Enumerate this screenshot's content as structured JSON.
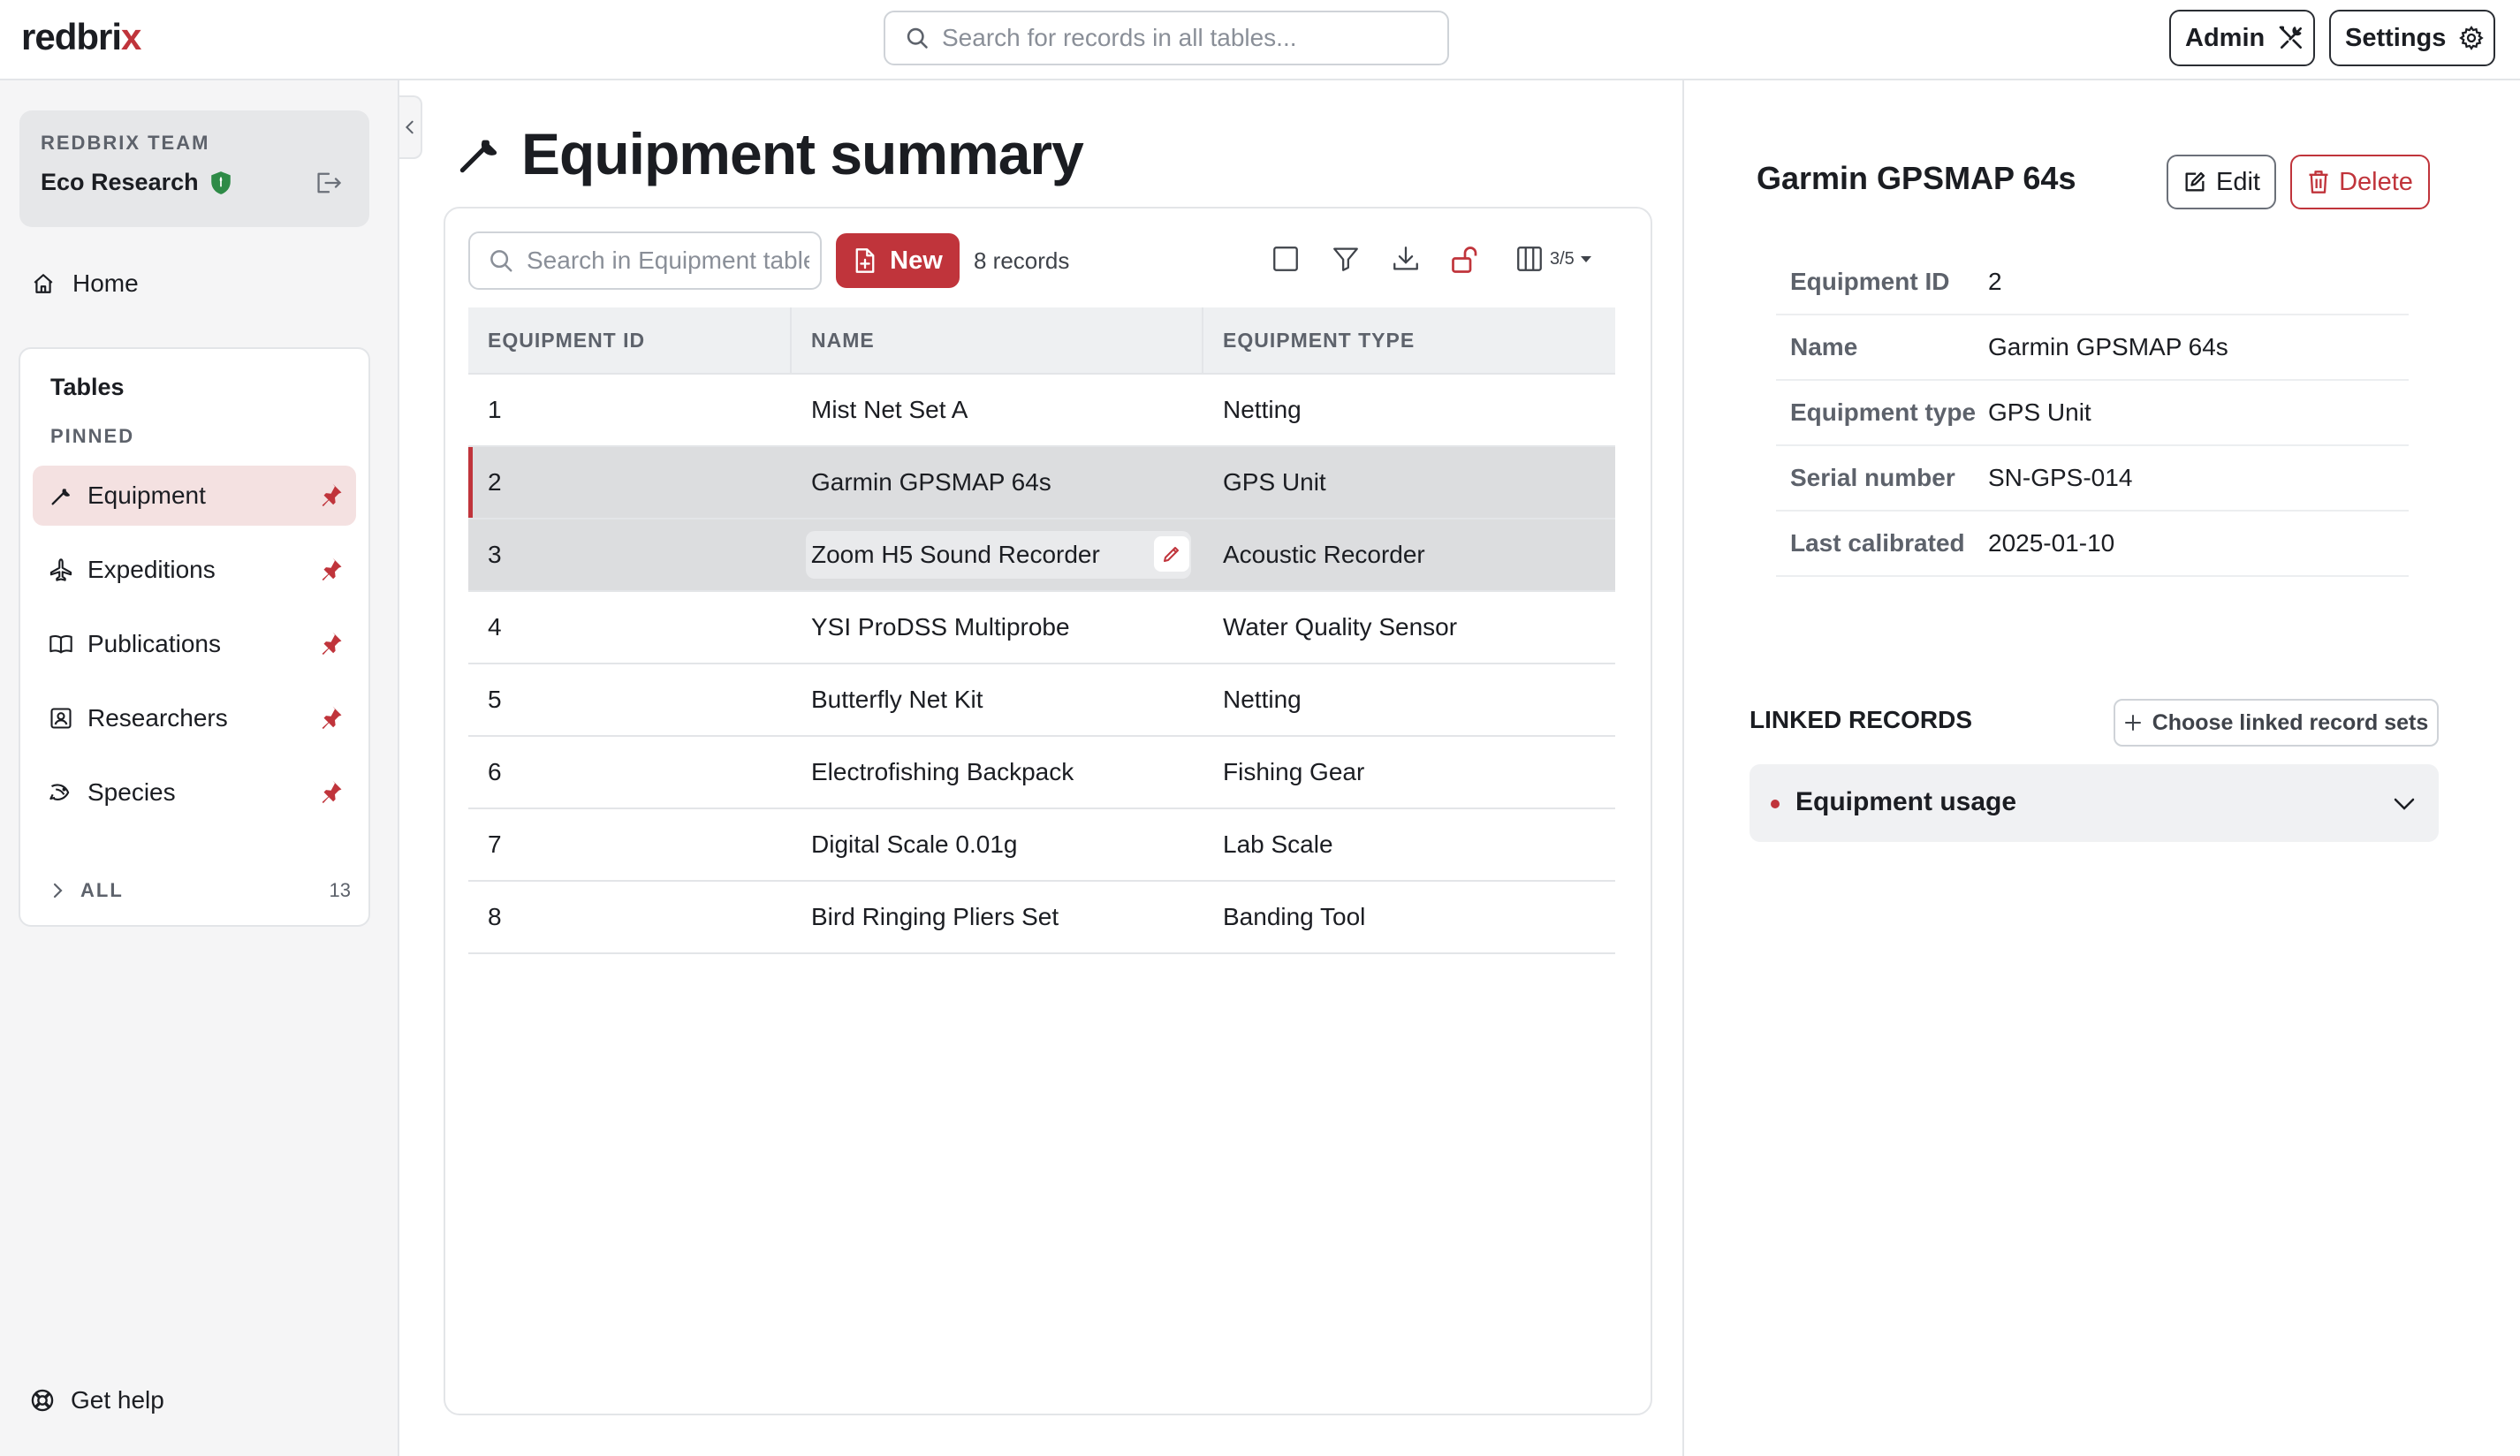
{
  "app": {
    "logo_text": "redbri",
    "logo_accent": "x"
  },
  "header": {
    "search_placeholder": "Search for records in all tables...",
    "admin_label": "Admin",
    "settings_label": "Settings"
  },
  "sidebar": {
    "team_label": "REDBRIX TEAM",
    "team_name": "Eco Research",
    "home_label": "Home",
    "tables_title": "Tables",
    "pinned_label": "PINNED",
    "items": [
      {
        "label": "Equipment",
        "icon": "wrench-icon",
        "active": true
      },
      {
        "label": "Expeditions",
        "icon": "plane-icon",
        "active": false
      },
      {
        "label": "Publications",
        "icon": "book-icon",
        "active": false
      },
      {
        "label": "Researchers",
        "icon": "id-badge-icon",
        "active": false
      },
      {
        "label": "Species",
        "icon": "fish-icon",
        "active": false
      }
    ],
    "all_label": "ALL",
    "all_count": "13",
    "help_label": "Get help"
  },
  "main": {
    "title": "Equipment summary",
    "search_placeholder": "Search in Equipment table",
    "new_label": "New",
    "record_count": "8 records",
    "columns_indicator": "3/5",
    "columns": [
      "EQUIPMENT ID",
      "NAME",
      "EQUIPMENT TYPE"
    ],
    "rows": [
      {
        "id": "1",
        "name": "Mist Net Set A",
        "type": "Netting"
      },
      {
        "id": "2",
        "name": "Garmin GPSMAP 64s",
        "type": "GPS Unit"
      },
      {
        "id": "3",
        "name": "Zoom H5 Sound Recorder",
        "type": "Acoustic Recorder"
      },
      {
        "id": "4",
        "name": "YSI ProDSS Multiprobe",
        "type": "Water Quality Sensor"
      },
      {
        "id": "5",
        "name": "Butterfly Net Kit",
        "type": "Netting"
      },
      {
        "id": "6",
        "name": "Electrofishing Backpack",
        "type": "Fishing Gear"
      },
      {
        "id": "7",
        "name": "Digital Scale 0.01g",
        "type": "Lab Scale"
      },
      {
        "id": "8",
        "name": "Bird Ringing Pliers Set",
        "type": "Banding Tool"
      }
    ]
  },
  "detail": {
    "title": "Garmin GPSMAP 64s",
    "edit_label": "Edit",
    "delete_label": "Delete",
    "fields": [
      {
        "key": "Equipment ID",
        "value": "2"
      },
      {
        "key": "Name",
        "value": "Garmin GPSMAP 64s"
      },
      {
        "key": "Equipment type",
        "value": "GPS Unit"
      },
      {
        "key": "Serial number",
        "value": "SN-GPS-014"
      },
      {
        "key": "Last calibrated",
        "value": "2025-01-10"
      }
    ],
    "linked_label": "LINKED RECORDS",
    "choose_label": "Choose linked record sets",
    "usage_label": "Equipment usage"
  },
  "colors": {
    "accent": "#c0343b",
    "text": "#1b1d22",
    "muted": "#5d626b"
  }
}
